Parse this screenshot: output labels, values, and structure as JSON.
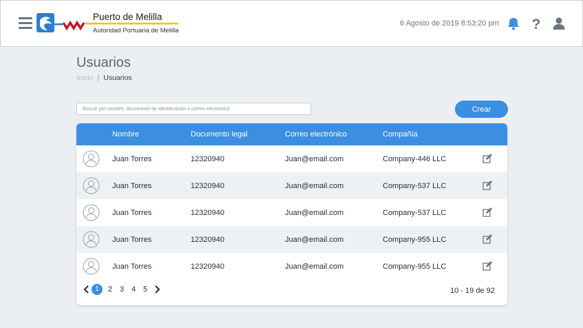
{
  "header": {
    "brand_title": "Puerto de Melilla",
    "brand_subtitle": "Autoridad Portuaria de Melilla",
    "datetime": "6 Agosto de 2019 8:53:20 pm"
  },
  "page": {
    "title": "Usuarios",
    "breadcrumb": {
      "home": "Inicio",
      "separator": "|",
      "current": "Usuarios"
    }
  },
  "search": {
    "placeholder": "Buscar por nombre, documento de identificación o correo electrónico",
    "value": ""
  },
  "create_label": "Crear",
  "table": {
    "columns": [
      "Nombre",
      "Documento legal",
      "Correo electrónico",
      "Compañía"
    ],
    "rows": [
      {
        "name": "Juan Torres",
        "document": "12320940",
        "email": "Juan@email.com",
        "company": "Company-446 LLC"
      },
      {
        "name": "Juan Torres",
        "document": "12320940",
        "email": "Juan@email.com",
        "company": "Company-537 LLC"
      },
      {
        "name": "Juan Torres",
        "document": "12320940",
        "email": "Juan@email.com",
        "company": "Company-537 LLC"
      },
      {
        "name": "Juan Torres",
        "document": "12320940",
        "email": "Juan@email.com",
        "company": "Company-955 LLC"
      },
      {
        "name": "Juan Torres",
        "document": "12320940",
        "email": "Juan@email.com",
        "company": "Company-955 LLC"
      }
    ]
  },
  "pagination": {
    "pages": [
      "1",
      "2",
      "3",
      "4",
      "5"
    ],
    "current": "1",
    "range": "10 - 19 de 92"
  },
  "colors": {
    "accent": "#3b8ee0",
    "background": "#eceff2",
    "brand_yellow": "#f2c200",
    "brand_red": "#c0162b"
  },
  "icons": [
    "menu-icon",
    "bell-icon",
    "help-icon",
    "user-icon",
    "avatar-icon",
    "edit-icon",
    "chevron-left-icon",
    "chevron-right-icon"
  ]
}
